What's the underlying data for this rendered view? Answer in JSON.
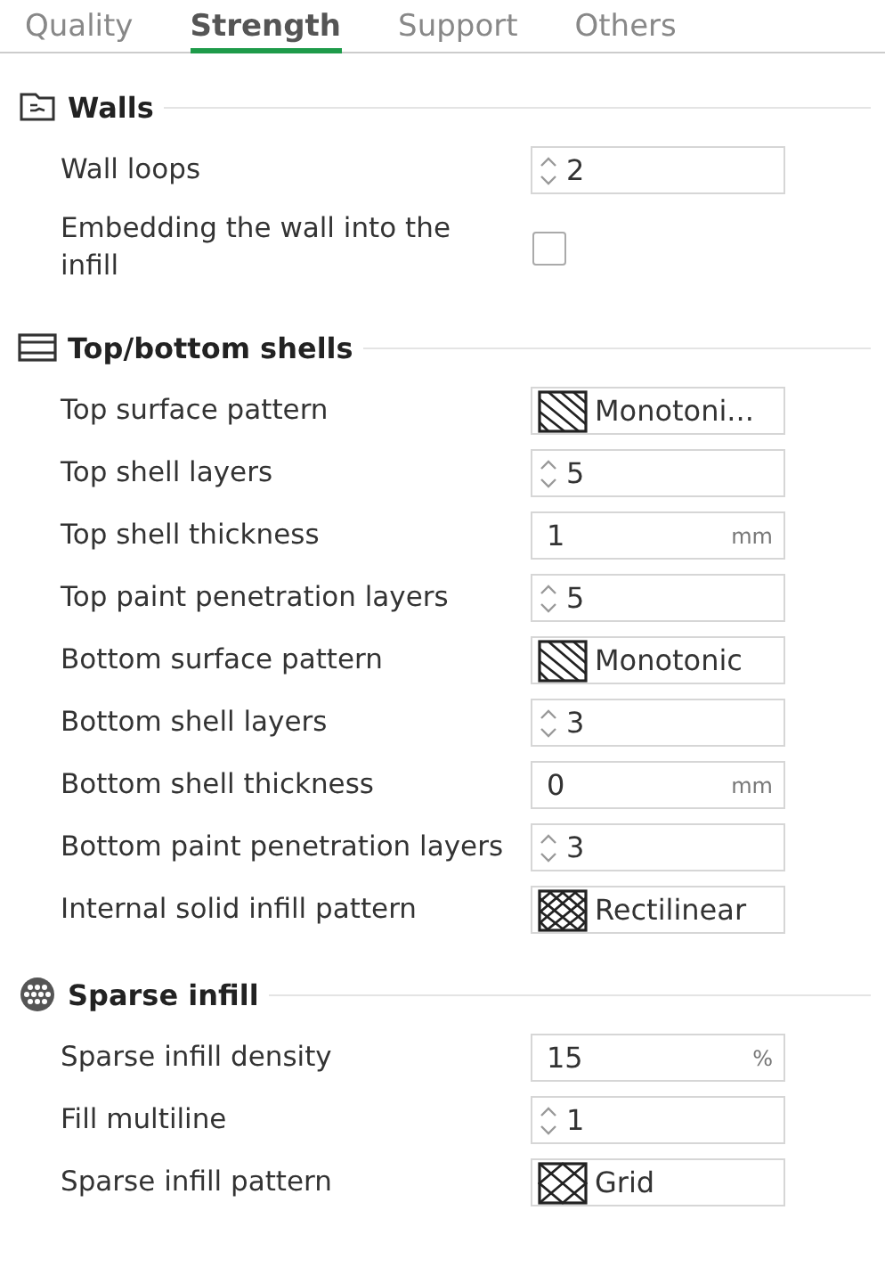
{
  "tabs": [
    {
      "label": "Quality",
      "selected": false
    },
    {
      "label": "Strength",
      "selected": true
    },
    {
      "label": "Support",
      "selected": false
    },
    {
      "label": "Others",
      "selected": false
    }
  ],
  "sections": [
    {
      "title": "Walls",
      "kind": "walls",
      "rows": [
        {
          "label": "Wall loops",
          "kind": "spin",
          "value": "2"
        },
        {
          "label": "Embedding the wall into the infill",
          "kind": "check",
          "checked": false
        }
      ]
    },
    {
      "title": "Top/bottom shells",
      "kind": "shells",
      "rows": [
        {
          "label": "Top surface pattern",
          "kind": "pattern-lines",
          "value": "Monotoni..."
        },
        {
          "label": "Top shell layers",
          "kind": "spin",
          "value": "5"
        },
        {
          "label": "Top shell thickness",
          "kind": "unit",
          "value": "1",
          "unit": "mm"
        },
        {
          "label": "Top paint penetration layers",
          "kind": "spin",
          "value": "5"
        },
        {
          "label": "Bottom surface pattern",
          "kind": "pattern-lines",
          "value": "Monotonic"
        },
        {
          "label": "Bottom shell layers",
          "kind": "spin",
          "value": "3"
        },
        {
          "label": "Bottom shell thickness",
          "kind": "unit",
          "value": "0",
          "unit": "mm"
        },
        {
          "label": "Bottom paint penetration layers",
          "kind": "spin",
          "value": "3"
        },
        {
          "label": "Internal solid infill pattern",
          "kind": "pattern-crosshatch",
          "value": "Rectilinear"
        }
      ]
    },
    {
      "title": "Sparse infill",
      "kind": "infill",
      "rows": [
        {
          "label": "Sparse infill density",
          "kind": "unit",
          "value": "15",
          "unit": "%"
        },
        {
          "label": "Fill multiline",
          "kind": "spin",
          "value": "1"
        },
        {
          "label": "Sparse infill pattern",
          "kind": "pattern-grid",
          "value": "Grid"
        }
      ]
    }
  ]
}
